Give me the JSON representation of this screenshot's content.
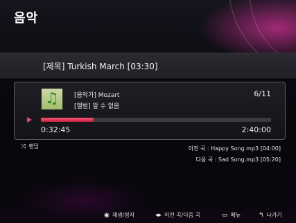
{
  "app": {
    "title": "음악"
  },
  "track": {
    "title": "[제목] Turkish March [03:30]"
  },
  "player": {
    "artist": "[음악가] Mozart",
    "album": "[앨범] 알 수 없음",
    "count": "6/11",
    "elapsed": "0:32:45",
    "total": "2:40:00",
    "progress_fraction": 0.23,
    "accent_color": "#e24a6a"
  },
  "mode": {
    "label": "랜덤",
    "icon": "shuffle-icon"
  },
  "queue": {
    "prev": "이전 곡 : Happy Song.mp3 [04:00]",
    "next": "다음 곡 : Sad Song.mp3 [05:20]"
  },
  "footer": {
    "play_stop": "재생/정지",
    "prev_next": "이전 곡/다음 곡",
    "menu": "메뉴",
    "exit": "나가기"
  }
}
